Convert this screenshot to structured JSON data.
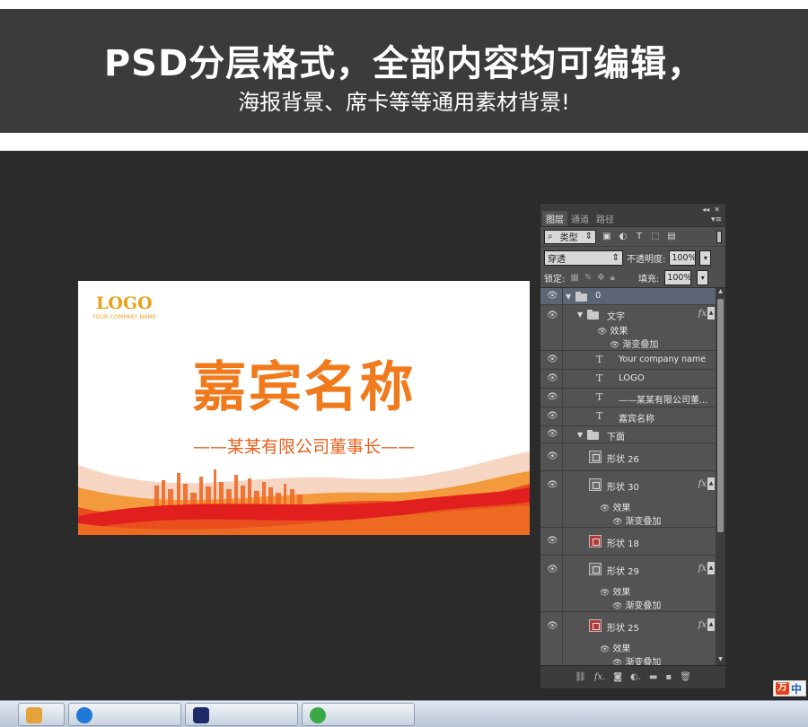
{
  "banner": {
    "title": "PSD分层格式，全部内容均可编辑，",
    "subtitle": "海报背景、席卡等等通用素材背景!"
  },
  "card": {
    "logo": "LOGO",
    "company": "YOUR COMPANY NAME",
    "name": "嘉宾名称",
    "title": "——某某有限公司董事长——"
  },
  "panel": {
    "tabs": [
      "图层",
      "通道",
      "路径"
    ],
    "filter_kind": "类型",
    "blend_mode": "穿透",
    "opacity_label": "不透明度:",
    "opacity_value": "100%",
    "lock_label": "锁定:",
    "fill_label": "填充:",
    "fill_value": "100%",
    "fx_label": "fx",
    "effects_label": "效果",
    "gradient_overlay_label": "渐变叠加",
    "layers": {
      "group_0": "0",
      "group_text": "文字",
      "text_company": "Your company name",
      "text_logo": "LOGO",
      "text_title": "——某某有限公司董...",
      "text_name": "嘉宾名称",
      "group_below": "下面",
      "shape_26": "形状 26",
      "shape_30": "形状 30",
      "shape_18": "形状 18",
      "shape_29": "形状 29",
      "shape_25": "形状 25"
    }
  },
  "ime": {
    "logo": "万",
    "lang": "中"
  },
  "colors": {
    "banner_bg": "#3b3b3b",
    "workspace_bg": "#2b2b2b",
    "card_name": "#f07a1c",
    "card_logo": "#e8a11a",
    "panel_bg": "#4f4f4f",
    "selected_layer": "#5c6574"
  }
}
